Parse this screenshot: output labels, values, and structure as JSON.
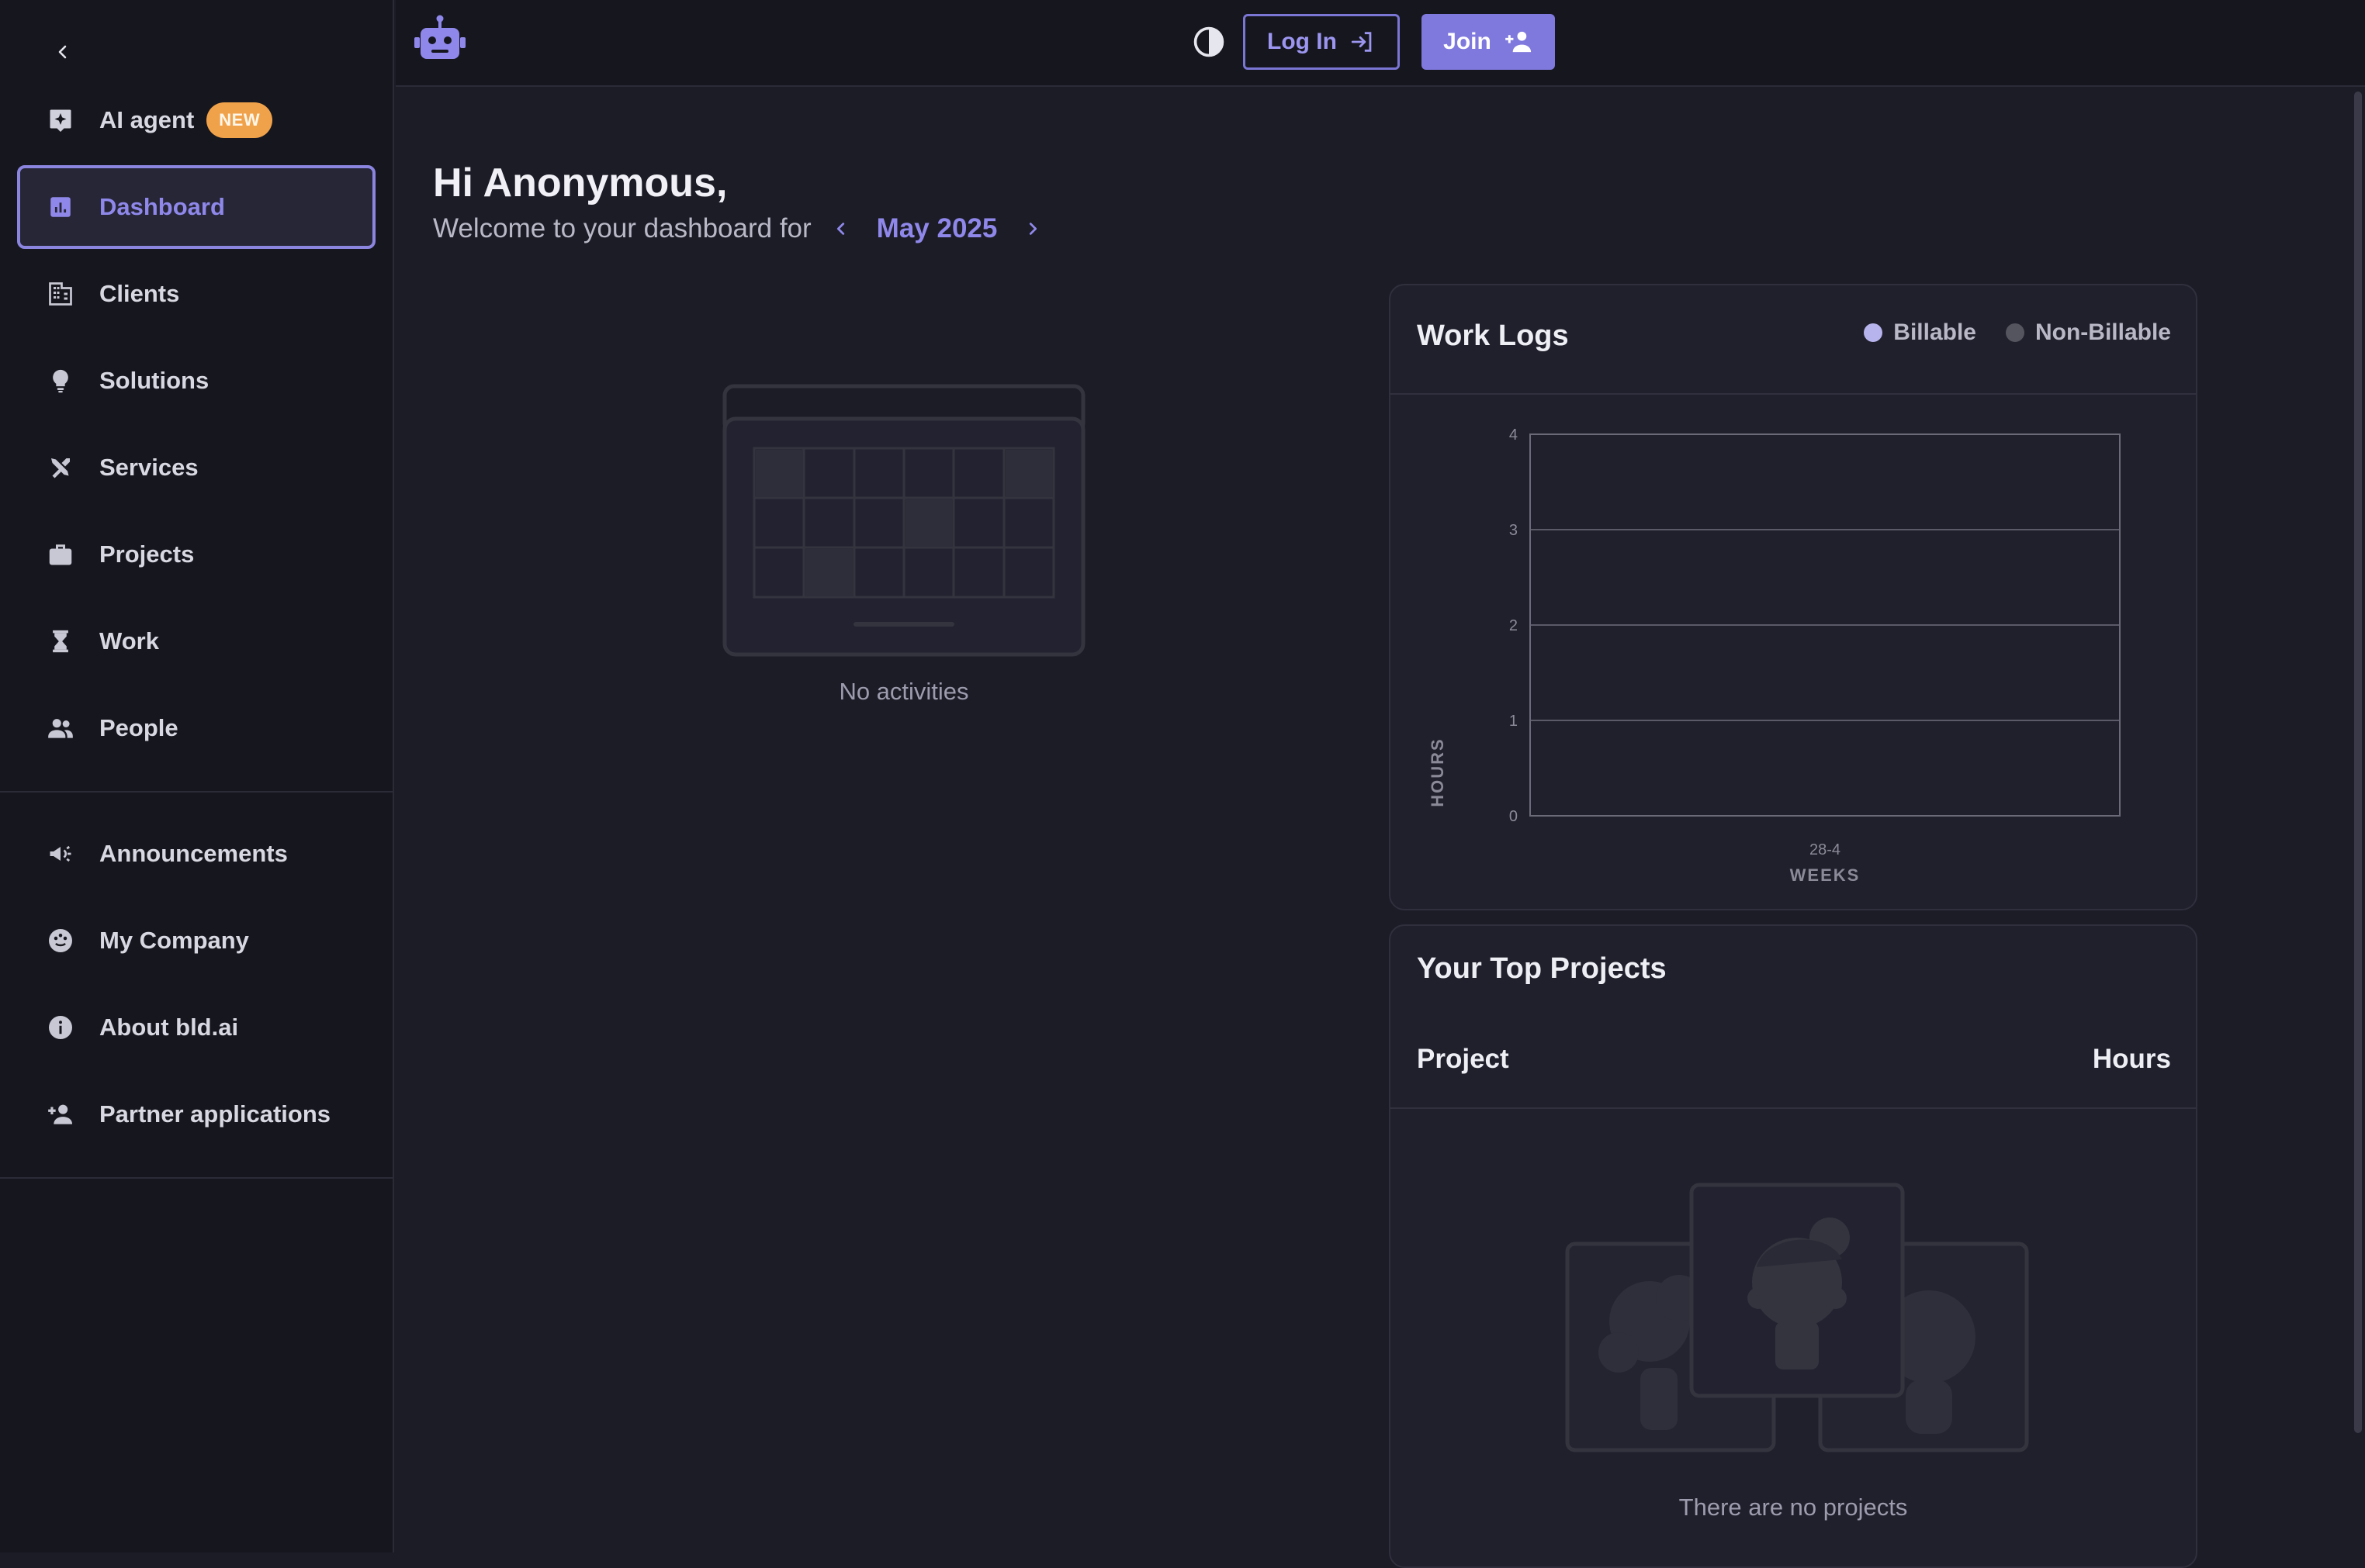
{
  "sidebar": {
    "collapse_icon": "chevron-left-icon",
    "items": [
      {
        "label": "AI agent",
        "icon": "sparkle-plus-icon",
        "badge": "NEW"
      },
      {
        "label": "Dashboard",
        "icon": "bar-chart-icon",
        "active": true
      },
      {
        "label": "Clients",
        "icon": "building-icon"
      },
      {
        "label": "Solutions",
        "icon": "lightbulb-icon"
      },
      {
        "label": "Services",
        "icon": "tools-icon"
      },
      {
        "label": "Projects",
        "icon": "briefcase-icon"
      },
      {
        "label": "Work",
        "icon": "hourglass-icon"
      },
      {
        "label": "People",
        "icon": "people-icon"
      }
    ],
    "secondary_items": [
      {
        "label": "Announcements",
        "icon": "megaphone-icon"
      },
      {
        "label": "My Company",
        "icon": "company-icon"
      },
      {
        "label": "About bld.ai",
        "icon": "info-icon"
      },
      {
        "label": "Partner applications",
        "icon": "person-add-icon"
      }
    ]
  },
  "topbar": {
    "logo_icon": "robot-icon",
    "theme_icon": "contrast-icon",
    "login_label": "Log In",
    "join_label": "Join"
  },
  "main": {
    "greeting": "Hi Anonymous,",
    "welcome_text": "Welcome to your dashboard for",
    "month": "May 2025",
    "no_activities": "No activities"
  },
  "work_logs": {
    "title": "Work Logs",
    "legend": [
      {
        "label": "Billable",
        "color": "#b7b3ec"
      },
      {
        "label": "Non-Billable",
        "color": "#55555f"
      }
    ]
  },
  "chart_data": {
    "type": "bar",
    "title": "Work Logs",
    "categories": [
      "28-4"
    ],
    "series": [
      {
        "name": "Billable",
        "values": [
          0
        ]
      },
      {
        "name": "Non-Billable",
        "values": [
          0
        ]
      }
    ],
    "xlabel": "WEEKS",
    "ylabel": "HOURS",
    "ylim": [
      0,
      4
    ],
    "yticks": [
      0,
      1,
      2,
      3,
      4
    ],
    "grid": true,
    "legend_position": "top-right"
  },
  "top_projects": {
    "title": "Your Top Projects",
    "columns": [
      "Project",
      "Hours"
    ],
    "rows": [],
    "empty_text": "There are no projects"
  }
}
